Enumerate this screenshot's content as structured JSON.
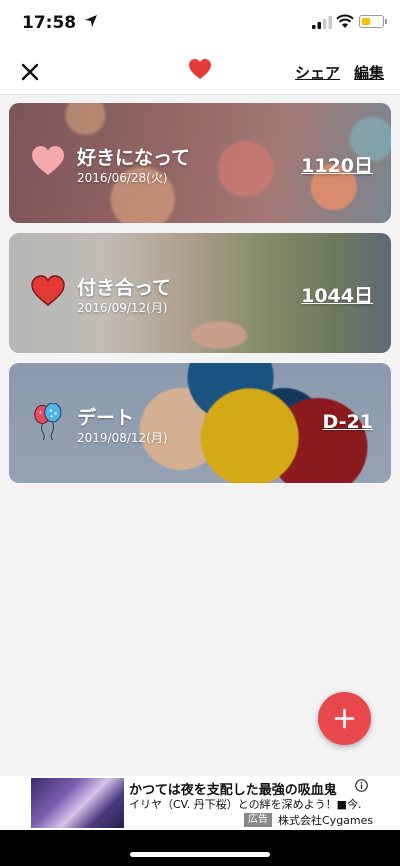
{
  "status": {
    "time": "17:58"
  },
  "nav": {
    "share_label": "シェア",
    "edit_label": "編集"
  },
  "events": [
    {
      "title": "好きになって",
      "date": "2016/06/28(火)",
      "count": "1120日",
      "icon": "heart-pink-icon"
    },
    {
      "title": "付き合って",
      "date": "2016/09/12(月)",
      "count": "1044日",
      "icon": "heart-red-icon"
    },
    {
      "title": "デート",
      "date": "2019/08/12(月)",
      "count": "D-21",
      "icon": "balloons-icon"
    }
  ],
  "ad": {
    "title": "かつては夜を支配した最強の吸血鬼",
    "subtitle": "イリヤ（CV. 丹下桜）との絆を深めよう！■今...",
    "badge": "広告",
    "company": "株式会社Cygames"
  },
  "colors": {
    "accent": "#e8484c",
    "heart": "#e53935",
    "pink_heart": "#f5a0a8"
  }
}
